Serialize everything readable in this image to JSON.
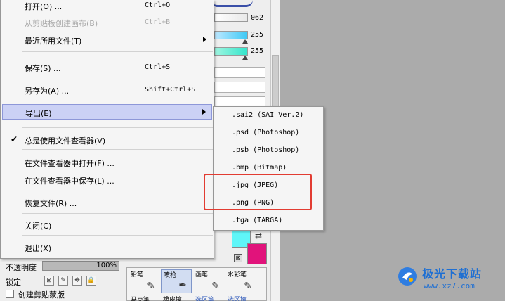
{
  "file_menu": {
    "items": [
      {
        "label": "打开(O) ...",
        "shortcut": "Ctrl+O",
        "disabled": false
      },
      {
        "label": "从剪贴板创建画布(B)",
        "shortcut": "Ctrl+B",
        "disabled": true
      },
      {
        "label": "最近所用文件(T)",
        "shortcut": "",
        "has_submenu": true
      },
      {
        "label": "保存(S) ...",
        "shortcut": "Ctrl+S"
      },
      {
        "label": "另存为(A) ...",
        "shortcut": "Shift+Ctrl+S"
      },
      {
        "label": "导出(E)",
        "shortcut": "",
        "has_submenu": true,
        "highlighted": true
      },
      {
        "label": "总是使用文件查看器(V)",
        "shortcut": "",
        "checked": true
      },
      {
        "label": "在文件查看器中打开(F) ...",
        "shortcut": ""
      },
      {
        "label": "在文件查看器中保存(L) ...",
        "shortcut": ""
      },
      {
        "label": "恢复文件(R) ...",
        "shortcut": ""
      },
      {
        "label": "关闭(C)",
        "shortcut": ""
      },
      {
        "label": "退出(X)",
        "shortcut": ""
      }
    ]
  },
  "export_submenu": {
    "items": [
      ".sai2 (SAI Ver.2)",
      ".psd (Photoshop)",
      ".psb (Photoshop)",
      ".bmp (Bitmap)",
      ".jpg (JPEG)",
      ".png (PNG)",
      ".tga (TARGA)"
    ]
  },
  "sliders": {
    "value_1": "062",
    "value_2": "255",
    "value_3": "255"
  },
  "layer_panel": {
    "opacity_label": "不透明度",
    "opacity_value": "100%",
    "opacity_level": 1.0,
    "lock_label": "锁定",
    "clip_label": "创建剪贴蒙版"
  },
  "tools": {
    "row1": [
      "铅笔",
      "喷枪",
      "画笔",
      "水彩笔"
    ],
    "row2": [
      "马克笔",
      "橡皮擦",
      "选区笔",
      "选区擦"
    ],
    "selected": "喷枪"
  },
  "colors": {
    "primary": "#5ff6f8",
    "secondary": "#e1137b",
    "highlight_box": "#e23c32"
  },
  "watermark": {
    "title": "极光下载站",
    "url": "www.xz7.com"
  }
}
